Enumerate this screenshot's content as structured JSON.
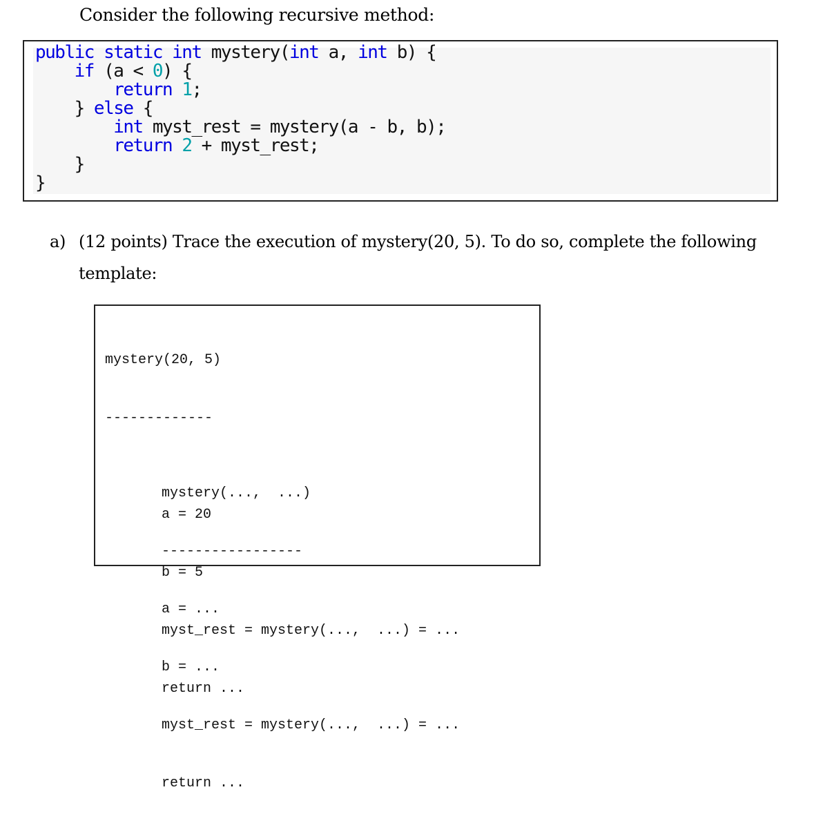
{
  "intro_text": "Consider the following recursive method:",
  "code": {
    "lines": [
      [
        {
          "t": "public static int",
          "c": "kw"
        },
        {
          "t": " mystery(",
          "c": ""
        },
        {
          "t": "int",
          "c": "kw"
        },
        {
          "t": " a, ",
          "c": ""
        },
        {
          "t": "int",
          "c": "kw"
        },
        {
          "t": " b) {",
          "c": ""
        }
      ],
      [
        {
          "t": "    ",
          "c": ""
        },
        {
          "t": "if",
          "c": "kw"
        },
        {
          "t": " (a < ",
          "c": ""
        },
        {
          "t": "0",
          "c": "num"
        },
        {
          "t": ") {",
          "c": ""
        }
      ],
      [
        {
          "t": "        ",
          "c": ""
        },
        {
          "t": "return",
          "c": "kw"
        },
        {
          "t": " ",
          "c": ""
        },
        {
          "t": "1",
          "c": "num"
        },
        {
          "t": ";",
          "c": ""
        }
      ],
      [
        {
          "t": "    } ",
          "c": ""
        },
        {
          "t": "else",
          "c": "kw"
        },
        {
          "t": " {",
          "c": ""
        }
      ],
      [
        {
          "t": "        ",
          "c": ""
        },
        {
          "t": "int",
          "c": "kw"
        },
        {
          "t": " myst_rest = mystery(a - b, b);",
          "c": ""
        }
      ],
      [
        {
          "t": "        ",
          "c": ""
        },
        {
          "t": "return",
          "c": "kw"
        },
        {
          "t": " ",
          "c": ""
        },
        {
          "t": "2",
          "c": "num"
        },
        {
          "t": " + myst_rest;",
          "c": ""
        }
      ],
      [
        {
          "t": "    }",
          "c": ""
        }
      ],
      [
        {
          "t": "}",
          "c": ""
        }
      ]
    ],
    "colors": {
      "keyword": "#0000e0",
      "number": "#00a0a8",
      "background": "#f6f6f6"
    }
  },
  "question": {
    "label": "a)",
    "text_line1": "(12 points) Trace the execution of mystery(20, 5). To do so, complete the following",
    "text_line2": "template:"
  },
  "template": {
    "frame1": {
      "header": "mystery(20, 5)",
      "separator": "-------------",
      "lines": [
        "a = 20",
        "b = 5",
        "myst_rest = mystery(...,  ...) = ...",
        "return ..."
      ]
    },
    "frame2": {
      "header": "mystery(...,  ...)",
      "separator": "-----------------",
      "lines": [
        "a = ...",
        "b = ...",
        "myst_rest = mystery(...,  ...) = ...",
        "return ..."
      ]
    }
  }
}
